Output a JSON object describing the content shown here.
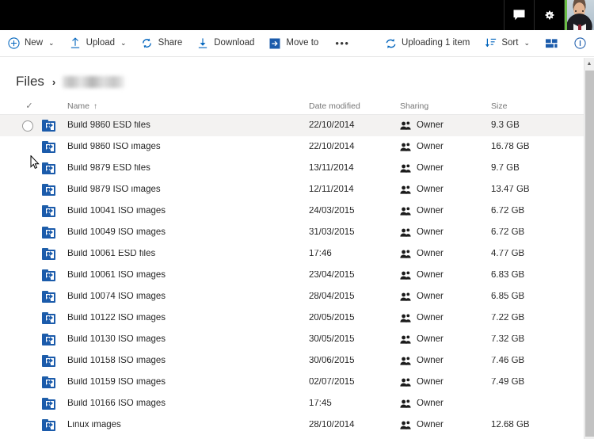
{
  "suite_bar": {
    "background": "#000000",
    "chat_icon": "chat-icon",
    "settings_icon": "gear-icon",
    "avatar_icon": "avatar",
    "avatar_accent": "#6bbd45"
  },
  "command_bar": {
    "accent": "#0064bd",
    "items": [
      {
        "label": "New",
        "icon": "plus-circle-icon",
        "caret": "⌄"
      },
      {
        "label": "Upload",
        "icon": "upload-arrow-icon",
        "caret": "⌄"
      },
      {
        "label": "Share",
        "icon": "share-link-icon",
        "caret": ""
      },
      {
        "label": "Download",
        "icon": "download-arrow-icon",
        "caret": ""
      },
      {
        "label": "Move to",
        "icon": "move-to-icon",
        "caret": ""
      }
    ],
    "overflow_label": "•••",
    "status_label": "Uploading 1 item",
    "status_icon": "sync-refresh-icon",
    "sort_label": "Sort",
    "sort_icon": "sort-descending-icon",
    "sort_caret": "⌄",
    "view_icon": "tiles-view-icon",
    "info_icon": "info-circle-icon"
  },
  "breadcrumb": {
    "root": "Files",
    "separator": "›",
    "current_redacted": true
  },
  "columns": {
    "check_glyph": "✓",
    "name": "Name",
    "sort_arrow": "↑",
    "date_modified": "Date modified",
    "sharing": "Sharing",
    "size": "Size"
  },
  "scrollbar": {
    "up_arrow": "▲"
  },
  "rows": [
    {
      "name": "Build 9860 ESD files",
      "date": "22/10/2014",
      "sharing": "Owner",
      "size": "9.3 GB",
      "hovered": true,
      "selectable": true
    },
    {
      "name": "Build 9860 ISO images",
      "date": "22/10/2014",
      "sharing": "Owner",
      "size": "16.78 GB",
      "hovered": false,
      "selectable": false
    },
    {
      "name": "Build 9879 ESD files",
      "date": "13/11/2014",
      "sharing": "Owner",
      "size": "9.7 GB",
      "hovered": false,
      "selectable": false
    },
    {
      "name": "Build 9879 ISO images",
      "date": "12/11/2014",
      "sharing": "Owner",
      "size": "13.47 GB",
      "hovered": false,
      "selectable": false
    },
    {
      "name": "Build 10041 ISO images",
      "date": "24/03/2015",
      "sharing": "Owner",
      "size": "6.72 GB",
      "hovered": false,
      "selectable": false
    },
    {
      "name": "Build 10049 ISO images",
      "date": "31/03/2015",
      "sharing": "Owner",
      "size": "6.72 GB",
      "hovered": false,
      "selectable": false
    },
    {
      "name": "Build 10061 ESD files",
      "date": "17:46",
      "sharing": "Owner",
      "size": "4.77 GB",
      "hovered": false,
      "selectable": false
    },
    {
      "name": "Build 10061 ISO images",
      "date": "23/04/2015",
      "sharing": "Owner",
      "size": "6.83 GB",
      "hovered": false,
      "selectable": false
    },
    {
      "name": "Build 10074 ISO images",
      "date": "28/04/2015",
      "sharing": "Owner",
      "size": "6.85 GB",
      "hovered": false,
      "selectable": false
    },
    {
      "name": "Build 10122 ISO images",
      "date": "20/05/2015",
      "sharing": "Owner",
      "size": "7.22 GB",
      "hovered": false,
      "selectable": false
    },
    {
      "name": "Build 10130 ISO images",
      "date": "30/05/2015",
      "sharing": "Owner",
      "size": "7.32 GB",
      "hovered": false,
      "selectable": false
    },
    {
      "name": "Build 10158 ISO images",
      "date": "30/06/2015",
      "sharing": "Owner",
      "size": "7.46 GB",
      "hovered": false,
      "selectable": false
    },
    {
      "name": "Build 10159 ISO images",
      "date": "02/07/2015",
      "sharing": "Owner",
      "size": "7.49 GB",
      "hovered": false,
      "selectable": false
    },
    {
      "name": "Build 10166 ISO images",
      "date": "17:45",
      "sharing": "Owner",
      "size": "",
      "hovered": false,
      "selectable": false
    },
    {
      "name": "Linux images",
      "date": "28/10/2014",
      "sharing": "Owner",
      "size": "12.68 GB",
      "hovered": false,
      "selectable": false
    }
  ]
}
